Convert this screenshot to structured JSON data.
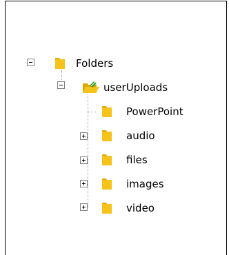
{
  "tree": {
    "root": {
      "label": "Folders",
      "expanded": true,
      "icon": "folder-icon",
      "children": [
        {
          "label": "userUploads",
          "expanded": true,
          "icon": "folder-open-icon",
          "children": [
            {
              "label": "PowerPoint",
              "expandable": false,
              "icon": "folder-icon"
            },
            {
              "label": "audio",
              "expandable": true,
              "expanded": false,
              "icon": "folder-icon"
            },
            {
              "label": "files",
              "expandable": true,
              "expanded": false,
              "icon": "folder-icon"
            },
            {
              "label": "images",
              "expandable": true,
              "expanded": false,
              "icon": "folder-icon"
            },
            {
              "label": "video",
              "expandable": true,
              "expanded": false,
              "icon": "folder-icon"
            }
          ]
        }
      ]
    }
  },
  "colors": {
    "folder_yellow": "#f6c21c",
    "folder_shadow": "#e0a800",
    "open_folder_green": "#3a9a2a"
  }
}
